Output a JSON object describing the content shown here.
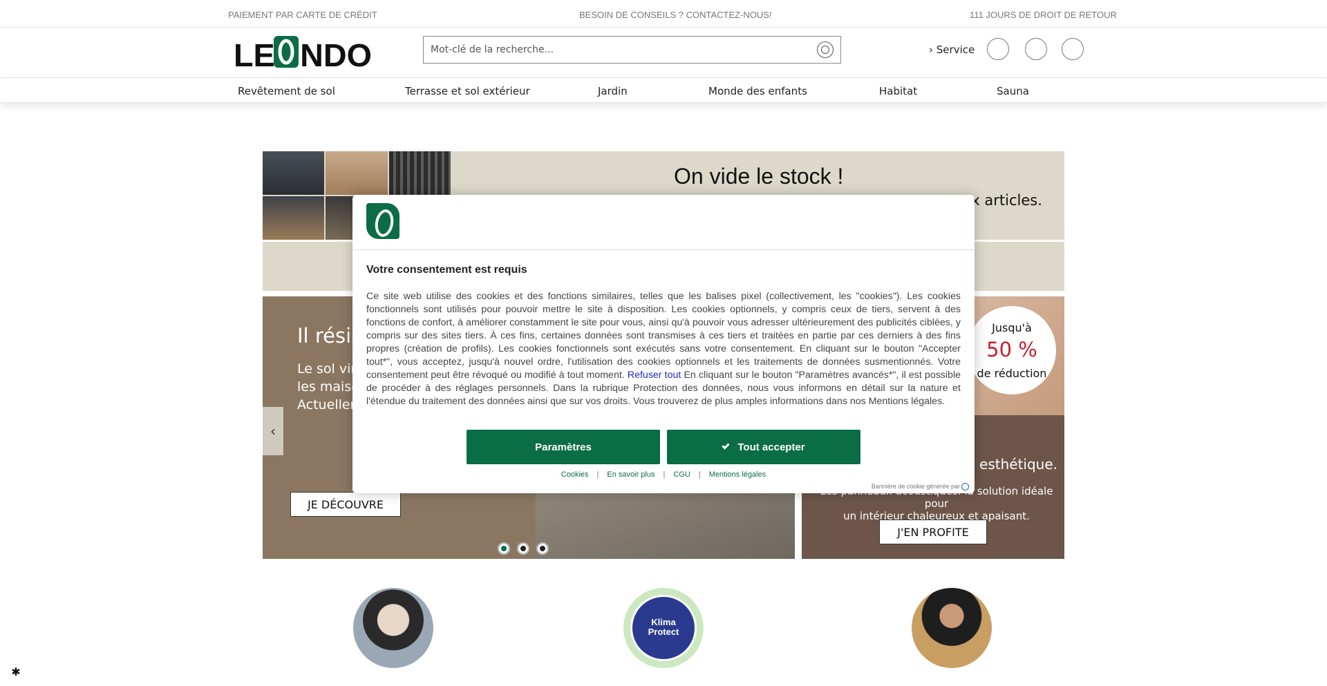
{
  "topbar": {
    "payment": "PAIEMENT PAR CARTE DE CRÉDIT",
    "advice": "BESOIN DE CONSEILS ? CONTACTEZ-NOUS!",
    "returns": "111 JOURS DE DROIT DE RETOUR"
  },
  "header": {
    "logo_text": "LEONDO",
    "search_placeholder": "Mot-clé de la recherche...",
    "service_label": "Service",
    "icons": [
      "heart-icon",
      "user-icon",
      "cart-icon"
    ]
  },
  "nav": {
    "items": [
      "Revêtement de sol",
      "Terrasse et sol extérieur",
      "Jardin",
      "Monde des enfants",
      "Habitat",
      "Sauna"
    ]
  },
  "hero": {
    "title": "On vide le stock !",
    "subtitle_visible": "ux articles."
  },
  "slider": {
    "title_visible": "Il résis",
    "text_line1": "Le sol vin",
    "text_line2": "les maiso",
    "text_line3": "Actueller",
    "cta": "JE DÉCOUVRE",
    "slide_count": 3,
    "active_slide": 1
  },
  "promo": {
    "badge_top": "Jusqu'à",
    "badge_value": "50 %",
    "badge_bottom": "de réduction",
    "title_visible": "esthétique.",
    "text_line1": "Les panneaux acoustiques: la solution idéale pour",
    "text_line2": "un intérieur chaleureux et apaisant.",
    "cta": "J'EN PROFITE"
  },
  "features": {
    "klima_line1": "Klima",
    "klima_line2": "Protect"
  },
  "cookie_modal": {
    "title": "Votre consentement est requis",
    "body_part1": "Ce site web utilise des cookies et des fonctions similaires, telles que les balises pixel (collectivement, les \"cookies\"). Les cookies fonctionnels sont utilisés pour pouvoir mettre le site à disposition. Les cookies optionnels, y compris ceux de tiers, servent à des fonctions de confort, à améliorer constamment le site pour vous, ainsi qu'à pouvoir vous adresser ultérieurement des publicités ciblées, y compris sur des sites tiers. À ces fins, certaines données sont transmises à ces tiers et traitées en partie par ces derniers à des fins propres (création de profils). Les cookies fonctionnels sont exécutés sans votre consentement. En cliquant sur le bouton \"Accepter tout*\", vous acceptez, jusqu'à nouvel ordre, l'utilisation des cookies optionnels et les traitements de données susmentionnés. Votre consentement peut être révoqué ou modifié à tout moment.",
    "reject_label": "Refuser tout",
    "body_part2": "En cliquant sur le bouton \"Paramètres avancés*\", il est possible de procéder à des réglages personnels. Dans la rubrique Protection des données, nous vous informons en détail sur la nature et l'étendue du traitement des données ainsi que sur vos droits. Vous trouverez de plus amples informations dans nos Mentions légales.",
    "params_button": "Paramètres",
    "accept_button": "Tout accepter",
    "links": [
      "Cookies",
      "En savoir plus",
      "CGU",
      "Mentions légales"
    ],
    "generated_by": "Bannière de cookie générée par"
  },
  "colors": {
    "brand_green": "#0b6d45",
    "promo_red": "#c8202b",
    "hero_beige": "#ddd9ca",
    "slide_brown": "#8b7761"
  }
}
